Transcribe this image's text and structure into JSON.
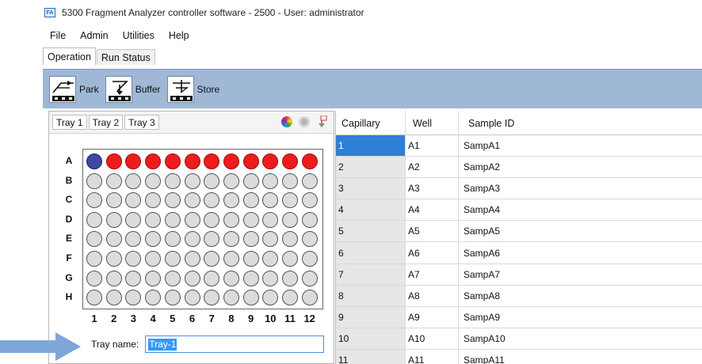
{
  "window": {
    "title": "5300 Fragment Analyzer controller software - 2500 - User: administrator"
  },
  "menu": [
    "File",
    "Admin",
    "Utilities",
    "Help"
  ],
  "tabs": [
    {
      "label": "Operation",
      "active": true
    },
    {
      "label": "Run Status",
      "active": false
    }
  ],
  "toolbar": {
    "buttons": [
      {
        "label": "Park",
        "icon": "park-icon"
      },
      {
        "label": "Buffer",
        "icon": "buffer-icon"
      },
      {
        "label": "Store",
        "icon": "store-icon"
      }
    ]
  },
  "tray_panel": {
    "tray_tabs": [
      "Tray 1",
      "Tray 2",
      "Tray 3"
    ],
    "row_labels": [
      "A",
      "B",
      "C",
      "D",
      "E",
      "F",
      "G",
      "H"
    ],
    "column_labels": [
      "1",
      "2",
      "3",
      "4",
      "5",
      "6",
      "7",
      "8",
      "9",
      "10",
      "11",
      "12"
    ],
    "row_a_states": [
      "blue",
      "red",
      "red",
      "red",
      "red",
      "red",
      "red",
      "red",
      "red",
      "red",
      "red",
      "red"
    ],
    "tray_name_label": "Tray name:",
    "tray_name_value": "Tray-1"
  },
  "grid": {
    "headers": [
      "Capillary",
      "Well",
      "Sample ID"
    ],
    "selected_row": 0,
    "rows": [
      [
        "1",
        "A1",
        "SampA1"
      ],
      [
        "2",
        "A2",
        "SampA2"
      ],
      [
        "3",
        "A3",
        "SampA3"
      ],
      [
        "4",
        "A4",
        "SampA4"
      ],
      [
        "5",
        "A5",
        "SampA5"
      ],
      [
        "6",
        "A6",
        "SampA6"
      ],
      [
        "7",
        "A7",
        "SampA7"
      ],
      [
        "8",
        "A8",
        "SampA8"
      ],
      [
        "9",
        "A9",
        "SampA9"
      ],
      [
        "10",
        "A10",
        "SampA10"
      ],
      [
        "11",
        "A11",
        "SampA11"
      ]
    ]
  },
  "colors": {
    "toolbar_bg": "#9fb8d6",
    "well_red": "#ee1c1c",
    "well_blue": "#3e47a3",
    "selection_blue": "#2f7fd6",
    "arrow_blue": "#7ea7d8"
  }
}
